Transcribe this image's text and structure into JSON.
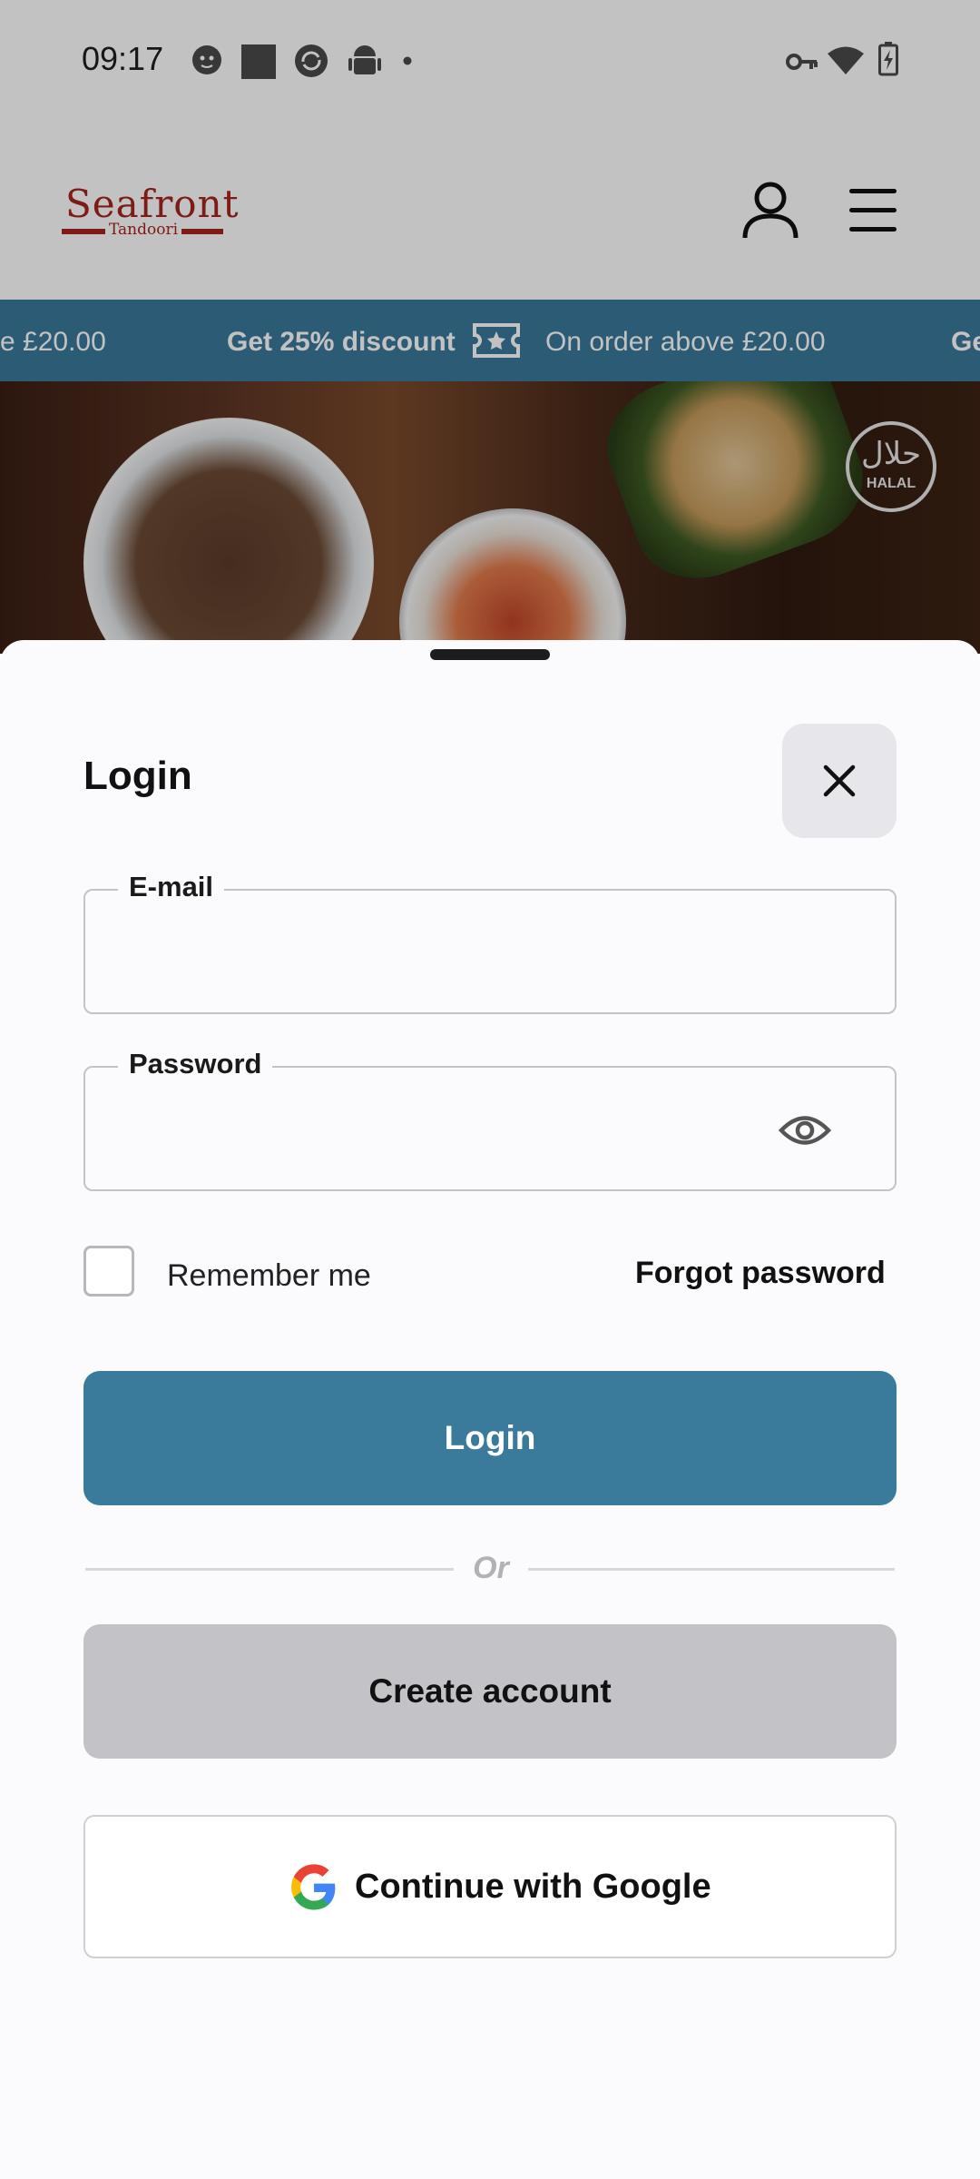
{
  "status_bar": {
    "time": "09:17",
    "left_icons": [
      "cat-face-icon",
      "square-icon",
      "sync-icon",
      "android-icon",
      "dot-icon"
    ],
    "right_icons": [
      "vpn-key-icon",
      "wifi-icon",
      "battery-charging-icon"
    ]
  },
  "header": {
    "logo_name": "Seafront",
    "logo_sub": "Tandoori",
    "brand_color": "#a5241b",
    "icons": [
      "user-icon",
      "menu-icon"
    ]
  },
  "promo": {
    "color": "#3a7a9a",
    "fragment_left": "e £20.00",
    "discount": "Get 25% discount",
    "condition": "On order above £20.00",
    "fragment_right": "Ge",
    "icon": "ticket-icon"
  },
  "hero": {
    "badge_arabic": "حلال",
    "badge_text": "HALAL"
  },
  "login_sheet": {
    "title": "Login",
    "close_icon": "close-icon",
    "email": {
      "label": "E-mail",
      "value": "",
      "placeholder": ""
    },
    "password": {
      "label": "Password",
      "value": "",
      "placeholder": "",
      "toggle_icon": "eye-icon"
    },
    "remember_me": {
      "label": "Remember me",
      "checked": false
    },
    "forgot_password": "Forgot password",
    "login_button": "Login",
    "divider_text": "Or",
    "create_account_button": "Create account",
    "google_button": "Continue with Google",
    "accent_color": "#3a7a9a"
  }
}
